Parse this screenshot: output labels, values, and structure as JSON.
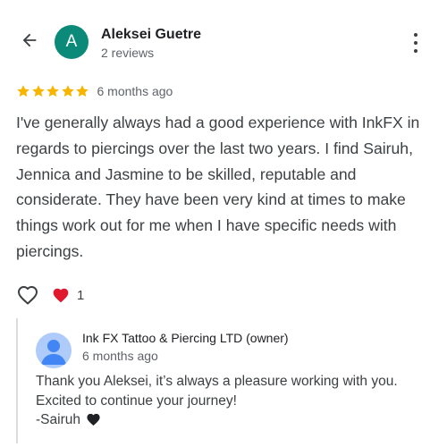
{
  "colors": {
    "avatar_bg": "#0b8a79",
    "star": "#f7b500",
    "heart_red": "#e0182d",
    "heart_black": "#202124",
    "owner_avatar_bg": "#aecbfa",
    "owner_avatar_fg": "#4285f4"
  },
  "header": {
    "back_icon": "arrow-left-icon",
    "avatar_letter": "A",
    "reviewer_name": "Aleksei Guetre",
    "reviewer_meta": "2 reviews",
    "menu_icon": "more-vert-icon"
  },
  "review": {
    "rating": 5,
    "rating_max": 5,
    "date": "6 months ago",
    "text": "I've generally always had a good experience with InkFX in regards to piercings over the last two years. I find Sairuh, Jennica and Jasmine to be skilled, reputable and considerate. They have been very kind at times to make things work out for me when I have specific needs with piercings."
  },
  "reactions": {
    "like_icon": "heart-outline-icon",
    "reaction_icon": "red-heart-icon",
    "count": "1"
  },
  "owner_reply": {
    "avatar_icon": "person-icon",
    "name": "Ink FX Tattoo & Piercing LTD (owner)",
    "date": "6 months ago",
    "line1": "Thank you Aleksei, it’s always a pleasure working with you.",
    "line2": "Excited to continue your journey!",
    "line3": "-Sairuh",
    "signature_icon": "black-heart-icon"
  }
}
